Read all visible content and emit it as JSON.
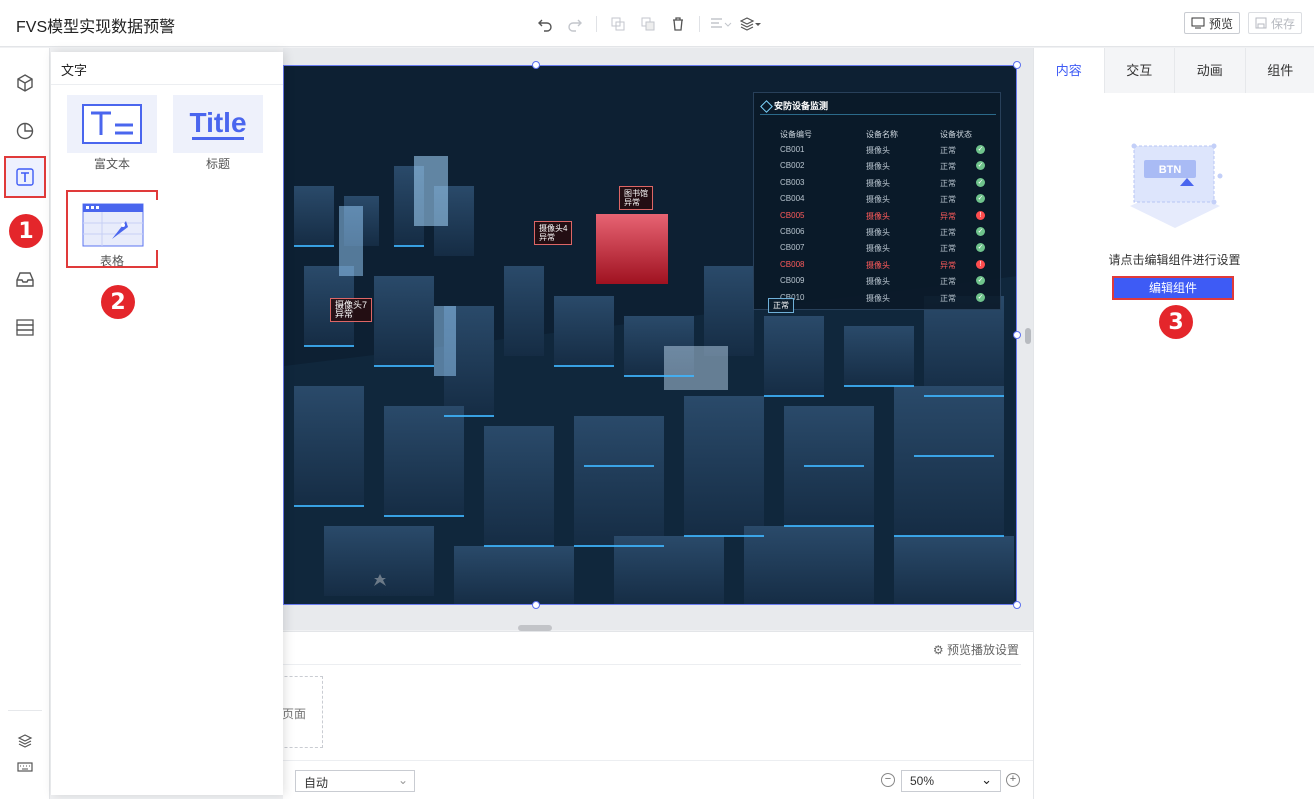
{
  "header": {
    "title": "FVS模型实现数据预警",
    "preview_label": "预览",
    "save_label": "保存"
  },
  "component_panel": {
    "title": "文字",
    "items": [
      {
        "label": "富文本",
        "thumb": "T="
      },
      {
        "label": "标题",
        "thumb": "Title"
      },
      {
        "label": "表格",
        "thumb": "table"
      }
    ]
  },
  "steps": [
    "1",
    "2",
    "3"
  ],
  "canvas": {
    "monitor": {
      "title": "安防设备监测",
      "columns": [
        "设备编号",
        "设备名称",
        "设备状态"
      ],
      "rows": [
        {
          "id": "CB001",
          "name": "摄像头",
          "status": "正常",
          "alarm": false
        },
        {
          "id": "CB002",
          "name": "摄像头",
          "status": "正常",
          "alarm": false
        },
        {
          "id": "CB003",
          "name": "摄像头",
          "status": "正常",
          "alarm": false
        },
        {
          "id": "CB004",
          "name": "摄像头",
          "status": "正常",
          "alarm": false
        },
        {
          "id": "CB005",
          "name": "摄像头",
          "status": "异常",
          "alarm": true
        },
        {
          "id": "CB006",
          "name": "摄像头",
          "status": "正常",
          "alarm": false
        },
        {
          "id": "CB007",
          "name": "摄像头",
          "status": "正常",
          "alarm": false
        },
        {
          "id": "CB008",
          "name": "摄像头",
          "status": "异常",
          "alarm": true
        },
        {
          "id": "CB009",
          "name": "摄像头",
          "status": "正常",
          "alarm": false
        },
        {
          "id": "CB010",
          "name": "摄像头",
          "status": "正常",
          "alarm": false
        }
      ]
    },
    "tags": {
      "library": "图书馆\n异常",
      "camera4": "摄像头4\n异常",
      "camera7": "摄像头7\n异常",
      "camera_normal": "正常"
    }
  },
  "bottom": {
    "preview_settings": "预览播放设置",
    "page_label": "页面",
    "auto_value": "自动",
    "zoom_value": "50%"
  },
  "right_panel": {
    "tabs": [
      "内容",
      "交互",
      "动画",
      "组件"
    ],
    "empty_text": "请点击编辑组件进行设置",
    "edit_button": "编辑组件",
    "illus_text": "BTN"
  },
  "colors": {
    "accent": "#3e5bf5",
    "highlight": "#e03a3a",
    "badge": "#e4262b"
  }
}
